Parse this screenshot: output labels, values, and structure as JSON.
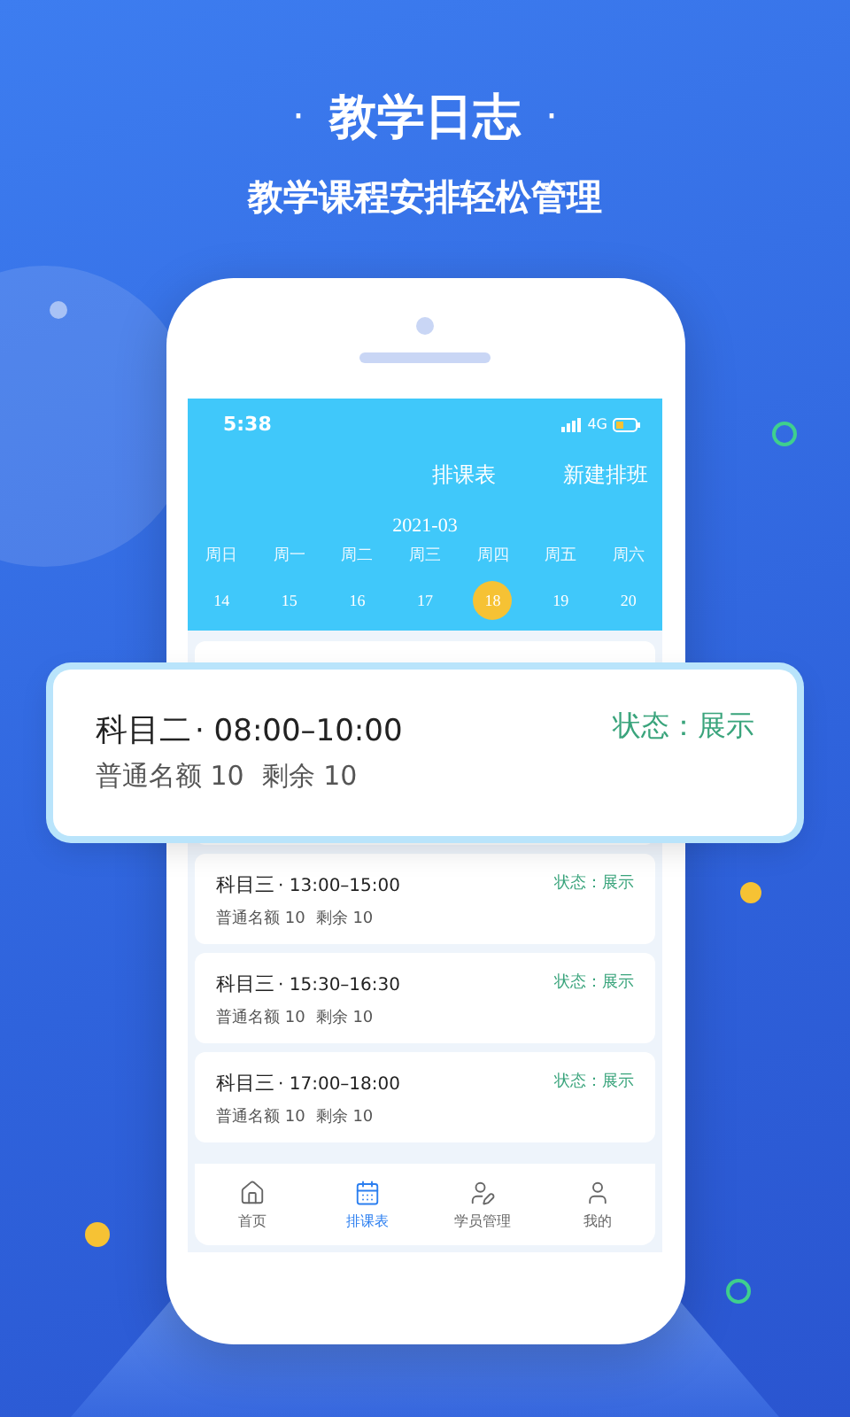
{
  "headline": {
    "dot_left": "·",
    "title": "教学日志",
    "dot_right": "·"
  },
  "subtitle": "教学课程安排轻松管理",
  "status_bar": {
    "time": "5:38",
    "network": "4G"
  },
  "header": {
    "title": "排课表",
    "action": "新建排班",
    "month": "2021-03"
  },
  "days": [
    {
      "weekday": "周日",
      "date": "14",
      "selected": false
    },
    {
      "weekday": "周一",
      "date": "15",
      "selected": false
    },
    {
      "weekday": "周二",
      "date": "16",
      "selected": false
    },
    {
      "weekday": "周三",
      "date": "17",
      "selected": false
    },
    {
      "weekday": "周四",
      "date": "18",
      "selected": true
    },
    {
      "weekday": "周五",
      "date": "19",
      "selected": false
    },
    {
      "weekday": "周六",
      "date": "20",
      "selected": false
    }
  ],
  "popup_card": {
    "subject": "科目二",
    "time": "· 08:00–10:00",
    "quota": "普通名额 10",
    "remaining": "剩余 10",
    "status": "状态：展示"
  },
  "cards": [
    {
      "subject": "科目三",
      "time": "· 13:00–15:00",
      "quota": "普通名额 10",
      "remaining": "剩余 10",
      "status": "状态：展示"
    },
    {
      "subject": "科目三",
      "time": "· 15:30–16:30",
      "quota": "普通名额 10",
      "remaining": "剩余 10",
      "status": "状态：展示"
    },
    {
      "subject": "科目三",
      "time": "· 17:00–18:00",
      "quota": "普通名额 10",
      "remaining": "剩余 10",
      "status": "状态：展示"
    }
  ],
  "tabs": [
    {
      "label": "首页",
      "selected": false
    },
    {
      "label": "排课表",
      "selected": true
    },
    {
      "label": "学员管理",
      "selected": false
    },
    {
      "label": "我的",
      "selected": false
    }
  ]
}
